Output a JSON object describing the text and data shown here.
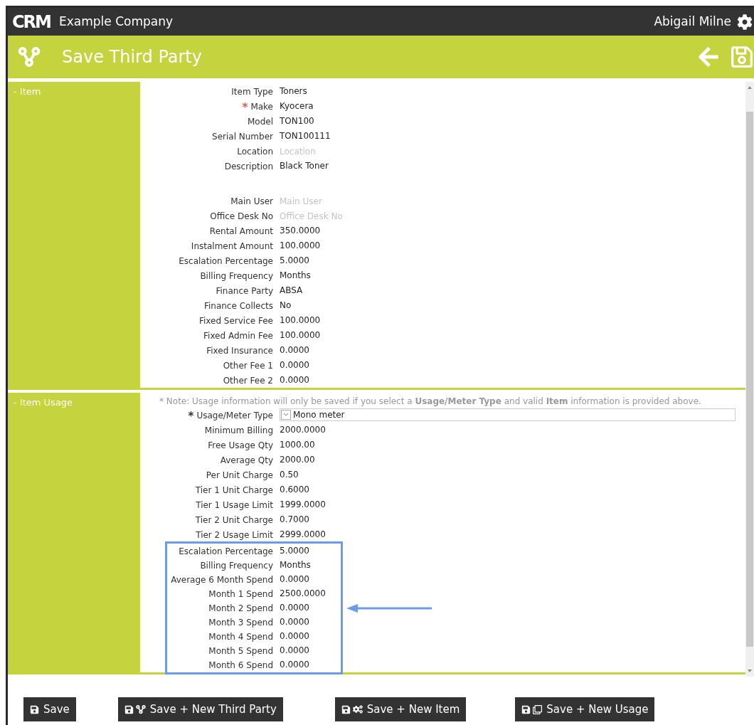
{
  "header": {
    "logo": "CRM",
    "company": "Example Company",
    "user": "Abigail Milne"
  },
  "title_bar": {
    "title": "Save Third Party"
  },
  "sections": [
    {
      "toggle": "-",
      "title": "Item",
      "rows": [
        {
          "label": "Item Type",
          "value": "Toners"
        },
        {
          "label": "Make",
          "value": "Kyocera",
          "required_mark": {
            "text": "*",
            "color": "#e05a5a"
          }
        },
        {
          "label": "Model",
          "value": "TON100"
        },
        {
          "label": "Serial Number",
          "value": "TON100111"
        },
        {
          "label": "Location",
          "placeholder": "Location"
        },
        {
          "label": "Description",
          "value": "Black Toner",
          "kind": "textarea"
        },
        {
          "label": "Main User",
          "placeholder": "Main User"
        },
        {
          "label": "Office Desk No",
          "placeholder": "Office Desk No"
        },
        {
          "label": "Rental Amount",
          "value": "350.0000"
        },
        {
          "label": "Instalment Amount",
          "value": "100.0000"
        },
        {
          "label": "Escalation Percentage",
          "value": "5.0000"
        },
        {
          "label": "Billing Frequency",
          "value": "Months"
        },
        {
          "label": "Finance Party",
          "value": "ABSA"
        },
        {
          "label": "Finance Collects",
          "value": "No"
        },
        {
          "label": "Fixed Service Fee",
          "value": "100.0000"
        },
        {
          "label": "Fixed Admin Fee",
          "value": "100.0000"
        },
        {
          "label": "Fixed Insurance",
          "value": "0.0000"
        },
        {
          "label": "Other Fee 1",
          "value": "0.0000"
        },
        {
          "label": "Other Fee 2",
          "value": "0.0000"
        }
      ]
    },
    {
      "toggle": "-",
      "title": "Item Usage",
      "note": "* Note: Usage information will only be saved if you select a **Usage/Meter Type** and valid **Item** information is provided above.",
      "rows": [
        {
          "label": "Usage/Meter Type",
          "value": "Mono meter",
          "required_mark": {
            "text": "*",
            "color": "#333333"
          },
          "kind": "select"
        },
        {
          "label": "Minimum Billing",
          "value": "2000.0000"
        },
        {
          "label": "Free Usage Qty",
          "value": "1000.00"
        },
        {
          "label": "Average Qty",
          "value": "2000.00"
        },
        {
          "label": "Per Unit Charge",
          "value": "0.50"
        },
        {
          "label": "Tier 1 Unit Charge",
          "value": "0.6000"
        },
        {
          "label": "Tier 1 Usage Limit",
          "value": "1999.0000"
        },
        {
          "label": "Tier 2 Unit Charge",
          "value": "0.7000"
        },
        {
          "label": "Tier 2 Usage Limit",
          "value": "2999.0000"
        }
      ],
      "highlighted_rows": [
        {
          "label": "Escalation Percentage",
          "value": "5.0000"
        },
        {
          "label": "Billing Frequency",
          "value": "Months"
        },
        {
          "label": "Average 6 Month Spend",
          "value": "0.0000"
        },
        {
          "label": "Month 1 Spend",
          "value": "2500.0000"
        },
        {
          "label": "Month 2 Spend",
          "value": "0.0000"
        },
        {
          "label": "Month 3 Spend",
          "value": "0.0000"
        },
        {
          "label": "Month 4 Spend",
          "value": "0.0000"
        },
        {
          "label": "Month 5 Spend",
          "value": "0.0000"
        },
        {
          "label": "Month 6 Spend",
          "value": "0.0000"
        }
      ]
    }
  ],
  "buttons": [
    {
      "label": "Save",
      "kind": "save"
    },
    {
      "label": "Save + New Third Party",
      "kind": "third_party"
    },
    {
      "label": "Save + New Item",
      "kind": "item"
    },
    {
      "label": "Save + New Usage",
      "kind": "usage"
    }
  ]
}
